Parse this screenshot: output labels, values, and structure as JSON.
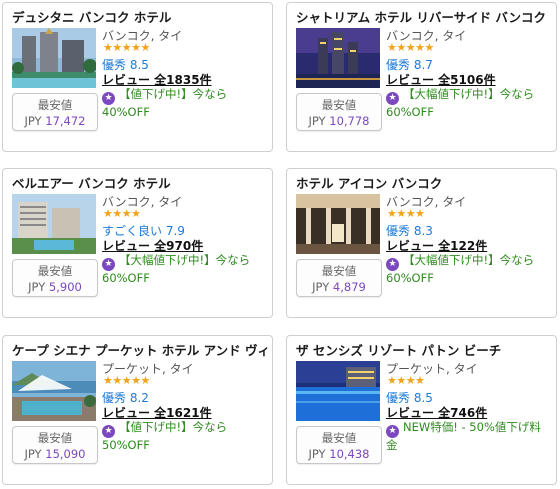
{
  "colors": {
    "rating": "#1d7ad7",
    "deal": "#2e8b1e",
    "price": "#7b48bf",
    "stars": "#f3a31a",
    "badge": "#7b48bf"
  },
  "hotels": [
    {
      "name": "デュシタニ バンコク ホテル",
      "location": "バンコク, タイ",
      "stars": "★★★★★",
      "rating": "優秀 8.5",
      "reviews": "レビュー 全1835件",
      "deal_line1": "【値下げ中!】今なら",
      "deal_line2": "40%OFF",
      "price_label": "最安値",
      "currency": "JPY",
      "price": "17,472",
      "photo_icon": "hotel-photo"
    },
    {
      "name": "シャトリアム ホテル リバーサイド バンコク",
      "location": "バンコク, タイ",
      "stars": "★★★★★",
      "rating": "優秀 8.7",
      "reviews": "レビュー 全5106件",
      "deal_line1": "【大幅値下げ中!】今なら",
      "deal_line2": "60%OFF",
      "price_label": "最安値",
      "currency": "JPY",
      "price": "10,778",
      "photo_icon": "hotel-photo"
    },
    {
      "name": "ベルエアー バンコク ホテル",
      "location": "バンコク, タイ",
      "stars": "★★★★",
      "rating": "すごく良い 7.9",
      "reviews": "レビュー 全970件",
      "deal_line1": "【大幅値下げ中!】今なら",
      "deal_line2": "60%OFF",
      "price_label": "最安値",
      "currency": "JPY",
      "price": "5,900",
      "photo_icon": "hotel-photo"
    },
    {
      "name": "ホテル アイコン バンコク",
      "location": "バンコク, タイ",
      "stars": "★★★★",
      "rating": "優秀 8.3",
      "reviews": "レビュー 全122件",
      "deal_line1": "【大幅値下げ中!】今なら",
      "deal_line2": "60%OFF",
      "price_label": "最安値",
      "currency": "JPY",
      "price": "4,879",
      "photo_icon": "hotel-photo"
    },
    {
      "name": "ケープ シエナ プーケット ホテル アンド ヴィラズ",
      "location": "プーケット, タイ",
      "stars": "★★★★★",
      "rating": "優秀 8.2",
      "reviews": "レビュー 全1621件",
      "deal_line1": "【値下げ中!】今なら",
      "deal_line2": "50%OFF",
      "price_label": "最安値",
      "currency": "JPY",
      "price": "15,090",
      "photo_icon": "hotel-photo"
    },
    {
      "name": "ザ センシズ リゾート パトン ビーチ",
      "location": "プーケット, タイ",
      "stars": "★★★★",
      "rating": "優秀 8.5",
      "reviews": "レビュー 全746件",
      "deal_line1": "NEW特価! - 50%値下げ料金",
      "deal_line2": "",
      "price_label": "最安値",
      "currency": "JPY",
      "price": "10,438",
      "photo_icon": "hotel-photo"
    }
  ]
}
